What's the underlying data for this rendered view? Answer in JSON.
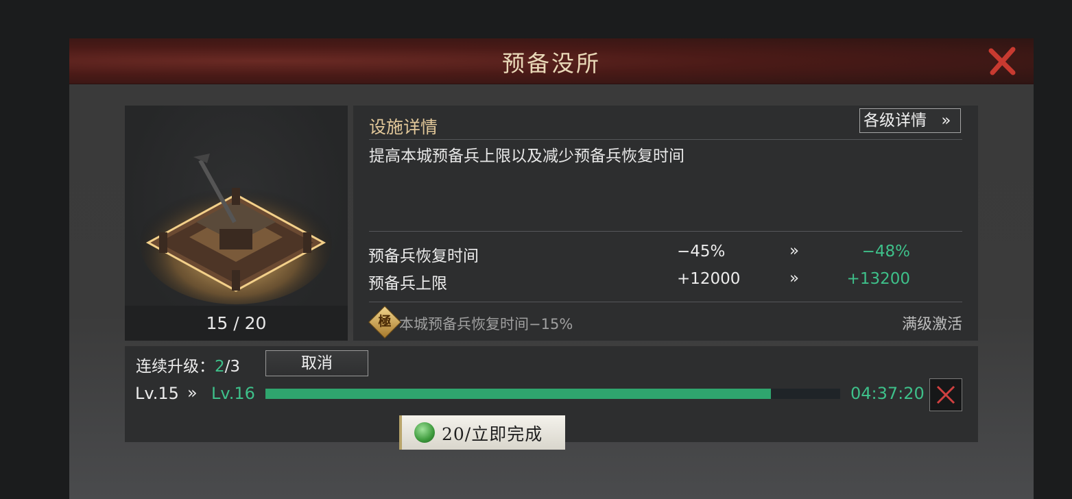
{
  "window": {
    "title": "预备没所"
  },
  "building": {
    "level_progress": "15 / 20"
  },
  "facility": {
    "header": "设施详情",
    "details_button": "各级详情",
    "details_button_icon": "double-chevron-right-icon",
    "description": "提高本城预备兵上限以及减少预备兵恢复时间",
    "stats": [
      {
        "label": "预备兵恢复时间",
        "current": "−45%",
        "arrow": "»",
        "next": "−48%"
      },
      {
        "label": "预备兵上限",
        "current": "+12000",
        "arrow": "»",
        "next": "+13200"
      }
    ],
    "max_bonus": {
      "icon_char": "極",
      "text": "本城预备兵恢复时间−15%",
      "status": "满级激活"
    }
  },
  "upgrade": {
    "continuous_label": "连续升级：",
    "continuous_current": "2",
    "continuous_total": "/3",
    "cancel_button": "取消",
    "from_level": "Lv.15",
    "arrow": "»",
    "to_level": "Lv.16",
    "progress_percent": 88,
    "timer": "04:37:20"
  },
  "instant": {
    "label": "20/立即完成",
    "icon": "jade-coin-icon"
  },
  "colors": {
    "accent_green": "#3ec08a",
    "title_gold": "#e9d9b8",
    "header_gold": "#e2c89a",
    "close_red": "#c83a30"
  }
}
